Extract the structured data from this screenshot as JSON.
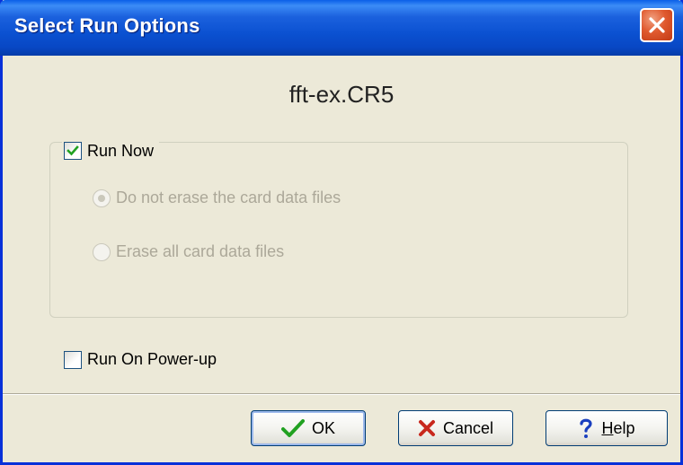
{
  "window": {
    "title": "Select Run Options"
  },
  "filename": "fft-ex.CR5",
  "run_now": {
    "label": "Run Now",
    "checked": true
  },
  "erase_options": [
    {
      "label": "Do not erase the card data files",
      "selected": true,
      "enabled": false
    },
    {
      "label": "Erase all card data files",
      "selected": false,
      "enabled": false
    }
  ],
  "run_on_powerup": {
    "label": "Run On Power-up",
    "checked": false
  },
  "buttons": {
    "ok": {
      "label": "OK",
      "icon": "checkmark-icon"
    },
    "cancel": {
      "label": "Cancel",
      "icon": "x-icon"
    },
    "help": {
      "label_mnemonic": "H",
      "label_rest": "elp",
      "icon": "question-icon"
    }
  },
  "colors": {
    "titlebar": "#0b51d1",
    "close_button": "#e05a2f",
    "dialog_background": "#ece9d8",
    "disabled_text": "#aca899",
    "ok_check": "#21a121",
    "cancel_x": "#c8281e",
    "help_question": "#1a3fbf"
  }
}
